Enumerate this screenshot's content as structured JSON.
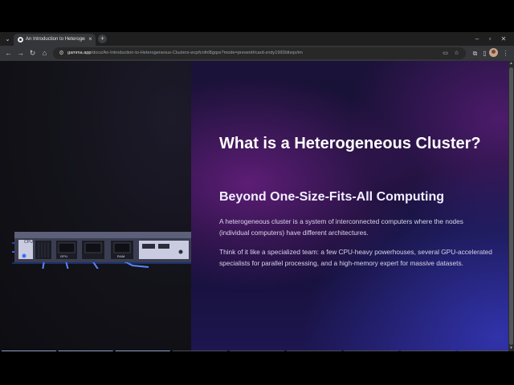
{
  "browser": {
    "tab": {
      "title": "An Introduction to Heterogeneous Clusters"
    },
    "url": {
      "host": "gamma.app",
      "path": "/docs/An-Introduction-to-Heterogeneous-Clusters-wcpfcnfnl8gqsx?mode=present#card-zndy19l03dtxqv/im"
    }
  },
  "slide": {
    "title": "What is a Heterogeneous Cluster?",
    "subtitle": "Beyond One-Size-Fits-All Computing",
    "paragraph_1": "A heterogeneous cluster is a system of interconnected computers where the nodes (individual computers) have different architectures.",
    "paragraph_2": "Think of it like a specialized team: a few CPU-heavy powerhouses, several GPU-accelerated specialists for parallel processing, and a high-memory expert for massive datasets.",
    "illustration": {
      "labels": [
        "CPU",
        "GPU",
        "RAM"
      ],
      "colors": {
        "chassis": "#4a4d62",
        "panel": "#c9cce0",
        "glow": "#3d6bff",
        "port": "#1b1c24"
      }
    },
    "progress": {
      "segments": 9,
      "current": 3
    }
  },
  "colors": {
    "accent": "#3d6bff",
    "background_left": "#121218",
    "background_right": "#1a1238",
    "text": "#ffffff"
  }
}
